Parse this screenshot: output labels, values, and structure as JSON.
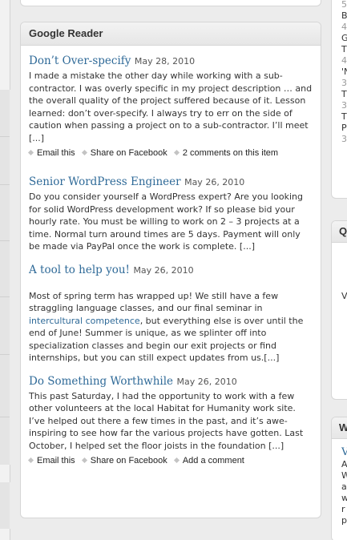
{
  "widget": {
    "title": "Google Reader"
  },
  "items": [
    {
      "title": "Don’t Over-specify",
      "date": "May 28, 2010",
      "body": "I made a mistake the other day while working with a sub-contractor.  I was overly specific in my project description … and the overall quality of the project suffered because of it.  Lesson learned: don’t over-specify. I always try to err on the side of caution when passing a project on to a sub-contractor.  I’ll meet [...]",
      "actions": [
        "Email this",
        "Share on Facebook",
        "2 comments on this item"
      ]
    },
    {
      "title": "Senior WordPress Engineer",
      "date": "May 26, 2010",
      "body": "Do you consider yourself a WordPress expert? Are you looking for solid WordPress development work? If so please bid your hourly rate. You must be willing to work on 2 – 3 projects at a time. Normal turn around times are 5 days. Payment will only be made via PayPal once the work is complete. [...]"
    },
    {
      "title": "A tool to help you!",
      "date": "May 26, 2010",
      "body_before": "Most of spring term has wrapped up!  We still have a few straggling language classes, and our final seminar in ",
      "body_link": "intercultural competence",
      "body_after": ", but everything else is over until the end of June!  Summer is unique, as we splinter off into specialization classes and begin our exit projects or find internships, but you can still expect updates from us.[...]"
    },
    {
      "title": "Do Something Worthwhile",
      "date": "May 26, 2010",
      "body": "This past Saturday, I had the opportunity to work with a few other volunteers at the local Habitat for Humanity work site.  I’ve helped out there a few times in the past, and it’s awe-inspiring to see how far the various projects have gotten.  Last October, I helped set the floor joists in the foundation [...]",
      "actions": [
        "Email this",
        "Share on Facebook",
        "Add a comment"
      ]
    }
  ],
  "right_column": {
    "lines_top": [
      "5",
      "B",
      "4",
      "G",
      "T",
      "4",
      "'N",
      "3",
      "T",
      "3",
      "T",
      "P",
      "3"
    ],
    "widget2_head": "Q",
    "widget2_line": "V",
    "widget3_head": "W",
    "widget3_link": "V",
    "widget3_lines": [
      "A",
      "W",
      "a",
      "w",
      "r",
      "p"
    ]
  },
  "colors": {
    "link": "#2f6a98",
    "background": "#ececec",
    "panel": "#ffffff"
  }
}
